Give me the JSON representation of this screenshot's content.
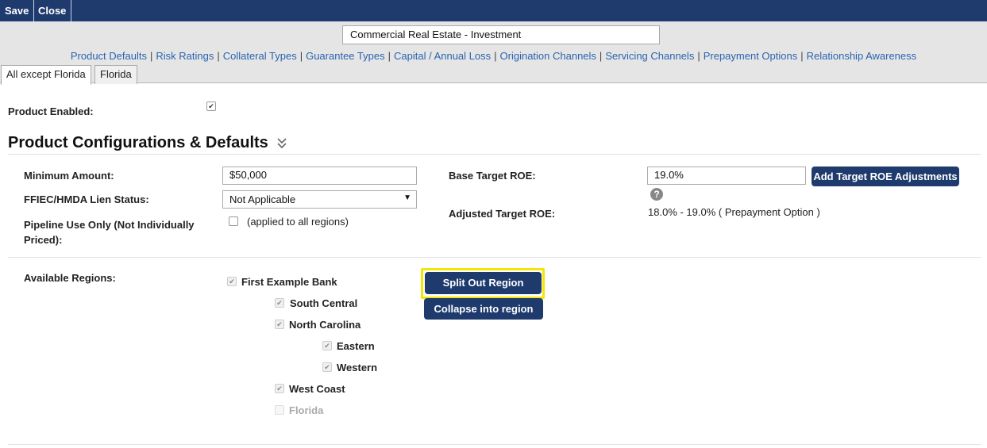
{
  "toolbar": {
    "save_label": "Save",
    "close_label": "Close"
  },
  "header": {
    "product_name": "Commercial Real Estate - Investment",
    "nav_links": [
      "Product Defaults",
      "Risk Ratings",
      "Collateral Types",
      "Guarantee Types",
      "Capital / Annual Loss",
      "Origination Channels",
      "Servicing Channels",
      "Prepayment Options",
      "Relationship Awareness"
    ],
    "tabs": [
      "All except Florida",
      "Florida"
    ]
  },
  "main": {
    "product_enabled_label": "Product Enabled:",
    "section_title": "Product Configurations & Defaults",
    "minimum_amount_label": "Minimum Amount:",
    "minimum_amount_value": "$50,000",
    "lien_status_label": "FFIEC/HMDA Lien Status:",
    "lien_status_value": "Not Applicable",
    "pipeline_label": "Pipeline Use Only (Not Individually Priced):",
    "pipeline_note": "(applied to all regions)",
    "base_roe_label": "Base Target ROE:",
    "base_roe_value": "19.0%",
    "add_roe_button": "Add Target ROE Adjustments",
    "adjusted_roe_label": "Adjusted Target ROE:",
    "adjusted_roe_value": "18.0% - 19.0% ( Prepayment Option )",
    "available_regions_label": "Available Regions:",
    "regions": [
      "First Example Bank",
      "South Central",
      "North Carolina",
      "Eastern",
      "Western",
      "West Coast",
      "Florida"
    ],
    "split_button": "Split Out Region",
    "collapse_button": "Collapse into region",
    "help_glyph": "?"
  }
}
